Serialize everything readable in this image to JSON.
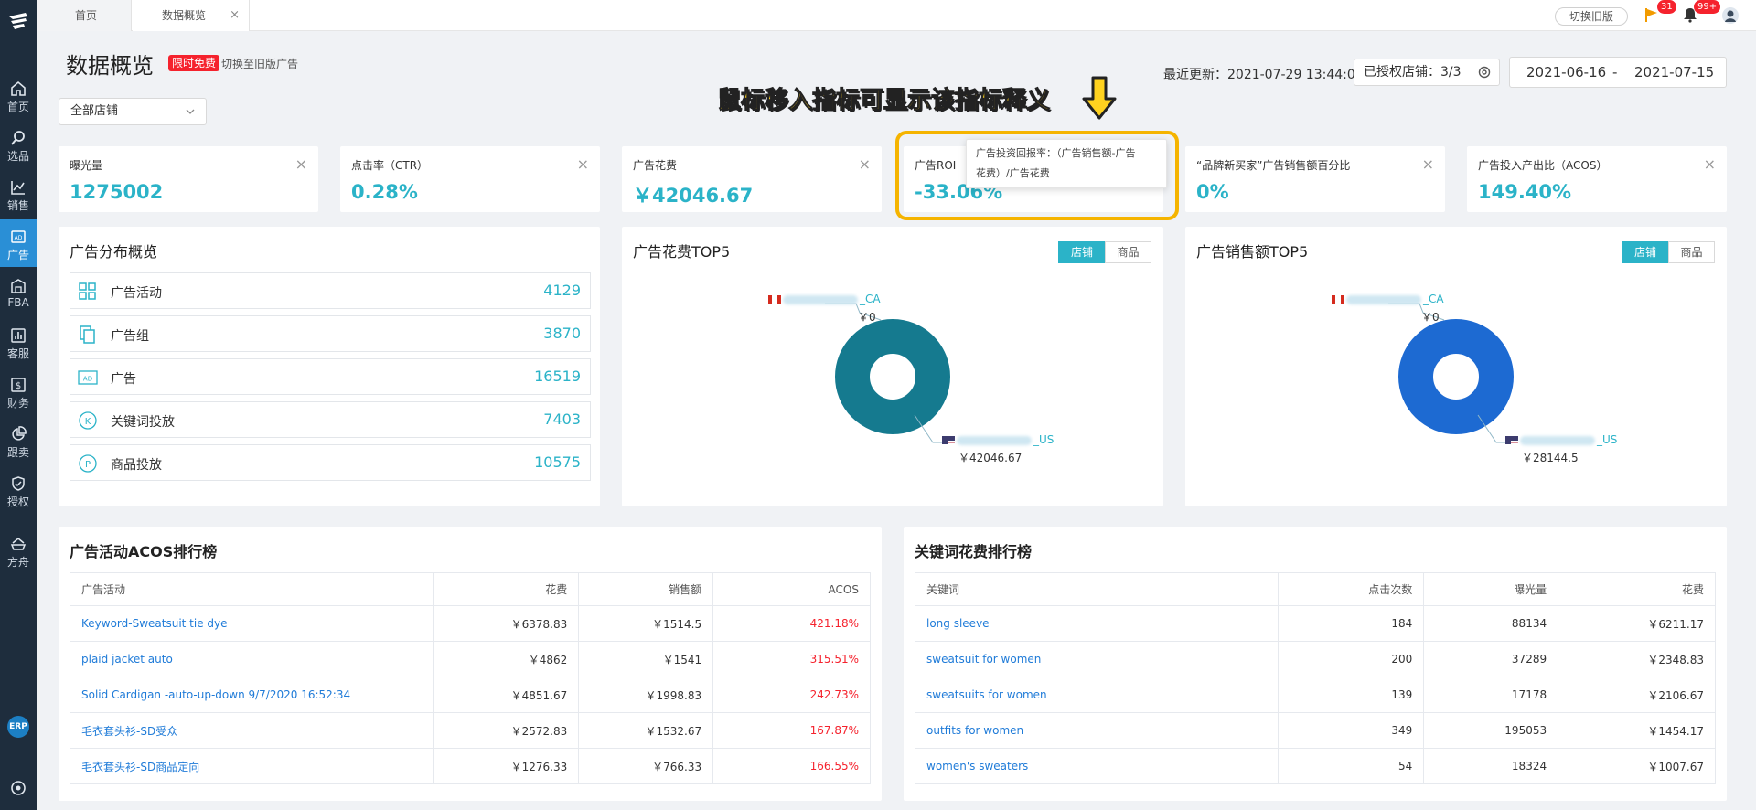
{
  "sidebar": {
    "items": [
      {
        "label": "首页",
        "icon": "home-icon"
      },
      {
        "label": "选品",
        "icon": "search-icon"
      },
      {
        "label": "销售",
        "icon": "line-chart-icon"
      },
      {
        "label": "广告",
        "icon": "ad-icon"
      },
      {
        "label": "FBA",
        "icon": "warehouse-icon"
      },
      {
        "label": "客服",
        "icon": "bar-chart-icon"
      },
      {
        "label": "财务",
        "icon": "dollar-icon"
      },
      {
        "label": "跟卖",
        "icon": "pie-chart-icon"
      },
      {
        "label": "授权",
        "icon": "shield-icon"
      },
      {
        "label": "方舟",
        "icon": "ark-icon"
      }
    ],
    "erp_label": "ERP"
  },
  "tabs": [
    {
      "label": "首页"
    },
    {
      "label": "数据概览"
    }
  ],
  "tab_close": "×",
  "topbar": {
    "old_version": "切换旧版",
    "flag_badge": "31",
    "bell_badge": "99+"
  },
  "header": {
    "title": "数据概览",
    "free_tag": "限时免费",
    "switch_old_ad": "切换至旧版广告",
    "updated": "最近更新：2021-07-29 13:44:01",
    "authorized": "已授权店铺：3/3",
    "date_start": "2021-06-16",
    "date_sep": "-",
    "date_end": "2021-07-15",
    "store_select": "全部店铺"
  },
  "annotation": {
    "text": "鼠标移入指标可显示该指标释义"
  },
  "metrics": [
    {
      "label": "曝光量",
      "value": "1275002"
    },
    {
      "label": "点击率（CTR）",
      "value": "0.28%"
    },
    {
      "label": "广告花费",
      "value": "￥42046.67"
    },
    {
      "label": "广告ROI",
      "value": "-33.06%"
    },
    {
      "label": "“品牌新买家”广告销售额百分比",
      "value": "0%"
    },
    {
      "label": "广告投入产出比（ACOS）",
      "value": "149.40%"
    }
  ],
  "metric_close": "×",
  "tooltip": {
    "line1": "广告投资回报率：（广告销售额-广告",
    "line2": "花费）/广告花费"
  },
  "distribution": {
    "title": "广告分布概览",
    "rows": [
      {
        "label": "广告活动",
        "value": "4129",
        "icon": "grid-icon"
      },
      {
        "label": "广告组",
        "value": "3870",
        "icon": "copy-icon"
      },
      {
        "label": "广告",
        "value": "16519",
        "icon": "ad-icon"
      },
      {
        "label": "关键词投放",
        "value": "7403",
        "icon": "k-circle-icon"
      },
      {
        "label": "商品投放",
        "value": "10575",
        "icon": "p-circle-icon"
      }
    ]
  },
  "spend_top5": {
    "title": "广告花费TOP5",
    "toggle": [
      "店铺",
      "商品"
    ],
    "ca_suffix": "_CA",
    "ca_value": "￥0",
    "us_suffix": "_US",
    "us_value": "￥42046.67",
    "color": "#157a8f"
  },
  "sales_top5": {
    "title": "广告销售额TOP5",
    "toggle": [
      "店铺",
      "商品"
    ],
    "ca_suffix": "_CA",
    "ca_value": "￥0",
    "us_suffix": "_US",
    "us_value": "￥28144.5",
    "color": "#1d6ad2"
  },
  "acos_table": {
    "title": "广告活动ACOS排行榜",
    "columns": [
      "广告活动",
      "花费",
      "销售额",
      "ACOS"
    ],
    "rows": [
      [
        "Keyword-Sweatsuit tie dye",
        "￥6378.83",
        "￥1514.5",
        "421.18%"
      ],
      [
        "plaid jacket auto",
        "￥4862",
        "￥1541",
        "315.51%"
      ],
      [
        "Solid Cardigan -auto-up-down 9/7/2020 16:52:34",
        "￥4851.67",
        "￥1998.83",
        "242.73%"
      ],
      [
        "毛衣套头衫-SD受众",
        "￥2572.83",
        "￥1532.67",
        "167.87%"
      ],
      [
        "毛衣套头衫-SD商品定向",
        "￥1276.33",
        "￥766.33",
        "166.55%"
      ]
    ]
  },
  "keyword_table": {
    "title": "关键词花费排行榜",
    "columns": [
      "关键词",
      "点击次数",
      "曝光量",
      "花费"
    ],
    "rows": [
      [
        "long sleeve",
        "184",
        "88134",
        "￥6211.17"
      ],
      [
        "sweatsuit for women",
        "200",
        "37289",
        "￥2348.83"
      ],
      [
        "sweatsuits for women",
        "139",
        "17178",
        "￥2106.67"
      ],
      [
        "outfits for women",
        "349",
        "195053",
        "￥1454.17"
      ],
      [
        "women's sweaters",
        "54",
        "18324",
        "￥1007.67"
      ]
    ]
  }
}
